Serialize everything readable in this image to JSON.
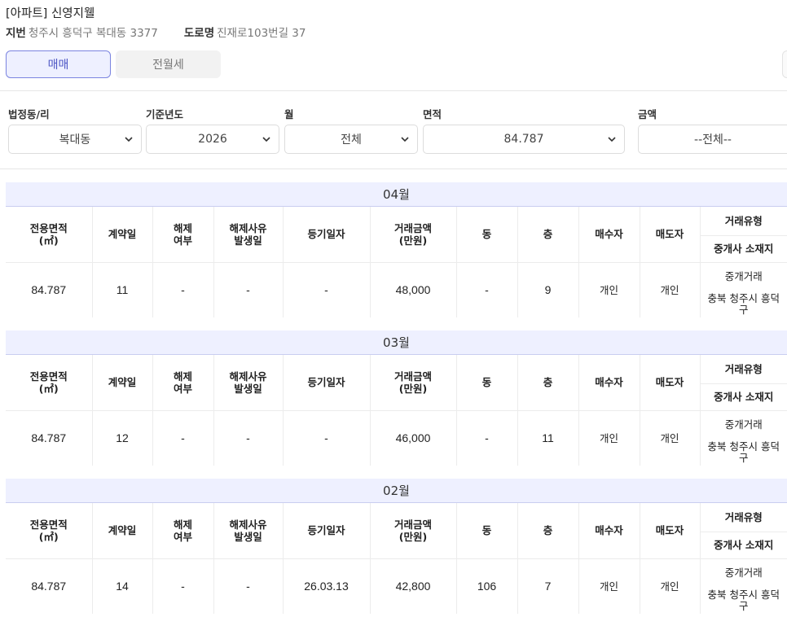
{
  "header": {
    "title": "[아파트] 신영지웰",
    "jibun_label": "지번",
    "jibun_value": "청주시 흥덕구 복대동 3377",
    "road_label": "도로명",
    "road_value": "진재로103번길 37"
  },
  "tabs": {
    "active": "매매",
    "inactive": "전월세"
  },
  "filters": {
    "dong": {
      "label": "법정동/리",
      "value": "복대동"
    },
    "year": {
      "label": "기준년도",
      "value": "2026"
    },
    "month": {
      "label": "월",
      "value": "전체"
    },
    "area": {
      "label": "면적",
      "value": "84.787"
    },
    "price": {
      "label": "금액",
      "value": "--전체--"
    }
  },
  "columns": {
    "area": "전용면적\n(㎡)",
    "contract_day": "계약일",
    "cancel": "해제\n여부",
    "cancel_date": "해제사유\n발생일",
    "reg_date": "등기일자",
    "price": "거래금액\n(만원)",
    "building": "동",
    "floor": "층",
    "buyer": "매수자",
    "seller": "매도자",
    "deal_type": "거래유형",
    "agent_loc": "중개사 소재지"
  },
  "months": [
    {
      "label": "04월",
      "row": {
        "area": "84.787",
        "day": "11",
        "cancel": "-",
        "cancel_date": "-",
        "reg_date": "-",
        "price": "48,000",
        "building": "-",
        "floor": "9",
        "buyer": "개인",
        "seller": "개인",
        "deal_type": "중개거래",
        "agent_loc": "충북 청주시 흥덕\n구"
      }
    },
    {
      "label": "03월",
      "row": {
        "area": "84.787",
        "day": "12",
        "cancel": "-",
        "cancel_date": "-",
        "reg_date": "-",
        "price": "46,000",
        "building": "-",
        "floor": "11",
        "buyer": "개인",
        "seller": "개인",
        "deal_type": "중개거래",
        "agent_loc": "충북 청주시 흥덕\n구"
      }
    },
    {
      "label": "02월",
      "row": {
        "area": "84.787",
        "day": "14",
        "cancel": "-",
        "cancel_date": "-",
        "reg_date": "26.03.13",
        "price": "42,800",
        "building": "106",
        "floor": "7",
        "buyer": "개인",
        "seller": "개인",
        "deal_type": "중개거래",
        "agent_loc": "충북 청주시 흥덕\n구"
      }
    }
  ],
  "icons": {
    "dropdown": "chevron-down-icon"
  }
}
